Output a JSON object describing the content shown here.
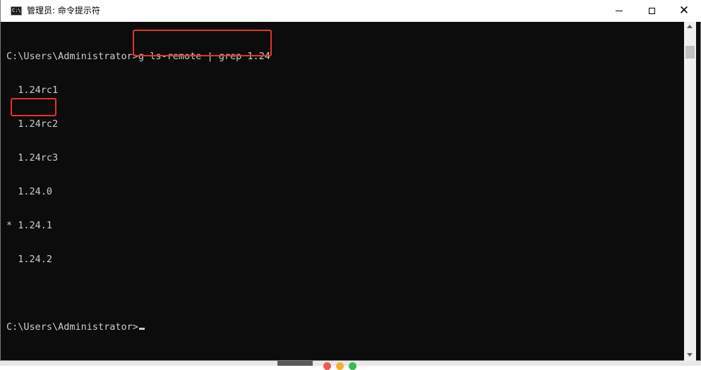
{
  "window": {
    "title": "管理员: 命令提示符",
    "icon_label": "C:\\"
  },
  "controls": {
    "minimize": "minimize-icon",
    "maximize": "maximize-icon",
    "close": "close-icon"
  },
  "console": {
    "lines": [
      "C:\\Users\\Administrator>g ls-remote | grep 1.24",
      "  1.24rc1",
      "  1.24rc2",
      "  1.24rc3",
      "  1.24.0",
      "* 1.24.1",
      "  1.24.2",
      "",
      "C:\\Users\\Administrator>"
    ]
  },
  "colors": {
    "console_bg": "#0c0c0c",
    "console_text": "#cccccc",
    "highlight": "#e8312a"
  }
}
